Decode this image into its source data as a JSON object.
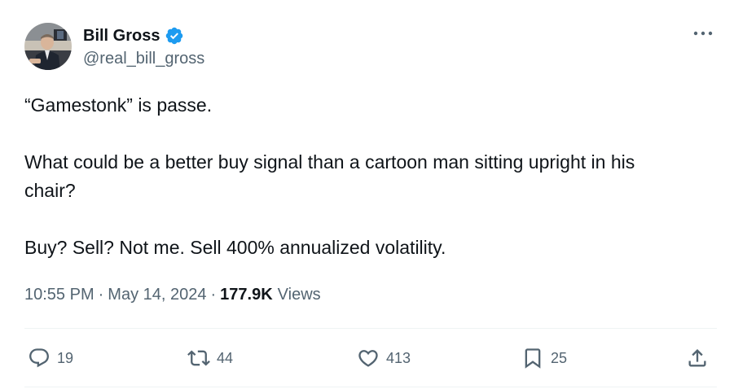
{
  "author": {
    "display_name": "Bill Gross",
    "handle": "@real_bill_gross",
    "verified": true
  },
  "tweet": {
    "paragraphs": [
      "“Gamestonk” is passe.",
      "What could be a better buy signal than a cartoon man sitting upright in his\nchair?",
      "Buy? Sell? Not me. Sell 400% annualized volatility."
    ],
    "time": "10:55 PM",
    "separator": "·",
    "date": "May 14, 2024",
    "views_count": "177.9K",
    "views_label": "Views"
  },
  "actions": {
    "replies": "19",
    "reposts": "44",
    "likes": "413",
    "bookmarks": "25"
  },
  "icons": {
    "more": "more-dots-icon",
    "verified": "verified-badge-icon",
    "reply": "reply-bubble-icon",
    "repost": "repost-arrows-icon",
    "like": "heart-icon",
    "bookmark": "bookmark-icon",
    "share": "share-upload-icon"
  },
  "colors": {
    "text": "#0f1419",
    "secondary": "#536471",
    "verified_blue": "#1d9bf0",
    "divider": "#eff3f4"
  }
}
